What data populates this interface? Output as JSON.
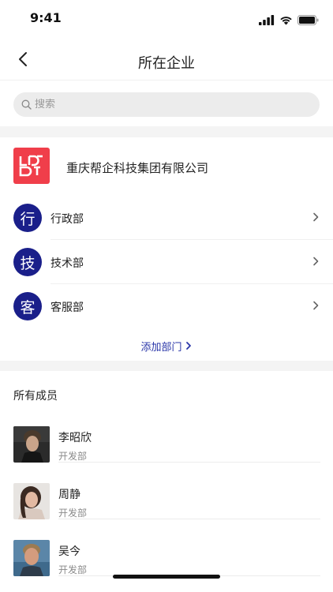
{
  "status_bar": {
    "time": "9:41"
  },
  "nav": {
    "title": "所在企业"
  },
  "search": {
    "placeholder": "搜索"
  },
  "company": {
    "name": "重庆帮企科技集团有限公司",
    "logo_color": "#f03e4a"
  },
  "departments": [
    {
      "avatar_char": "行",
      "name": "行政部"
    },
    {
      "avatar_char": "技",
      "name": "技术部"
    },
    {
      "avatar_char": "客",
      "name": "客服部"
    }
  ],
  "add_department": {
    "label": "添加部门"
  },
  "members_section": {
    "title": "所有成员"
  },
  "members": [
    {
      "name": "李昭欣",
      "department": "开发部"
    },
    {
      "name": "周静",
      "department": "开发部"
    },
    {
      "name": "吴今",
      "department": "开发部"
    }
  ],
  "colors": {
    "accent": "#1a1f8a",
    "link": "#2a36a8",
    "background_band": "#f4f4f4"
  }
}
